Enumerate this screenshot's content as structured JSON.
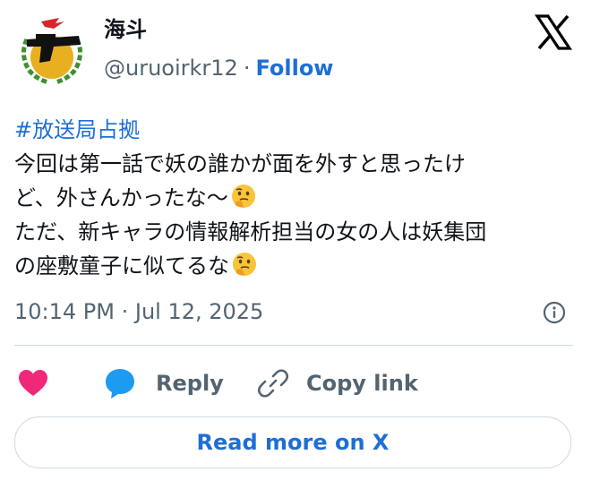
{
  "author": {
    "display_name": "海斗",
    "handle": "@uruoirkr12",
    "separator": "·",
    "follow_label": "Follow",
    "avatar_icon": "pistol-emblem-icon"
  },
  "platform_logo": "x-logo-icon",
  "tweet": {
    "hashtag": "#放送局占拠",
    "lines": [
      "今回は第一話で妖の誰かが面を外すと思ったけ",
      "ど、外さんかったな〜",
      "ただ、新キャラの情報解析担当の女の人は妖集団",
      "の座敷童子に似てるな"
    ],
    "emoji": "thinking-face-icon"
  },
  "timestamp": "10:14 PM · Jul 12, 2025",
  "actions": {
    "like_icon": "heart-icon",
    "reply_label": "Reply",
    "copy_label": "Copy link"
  },
  "read_more_label": "Read more on X",
  "colors": {
    "link": "#1d6fd6",
    "heart": "#f0287a",
    "reply_bubble": "#1d9bf0",
    "muted": "#536471",
    "border": "#cfd9de"
  }
}
